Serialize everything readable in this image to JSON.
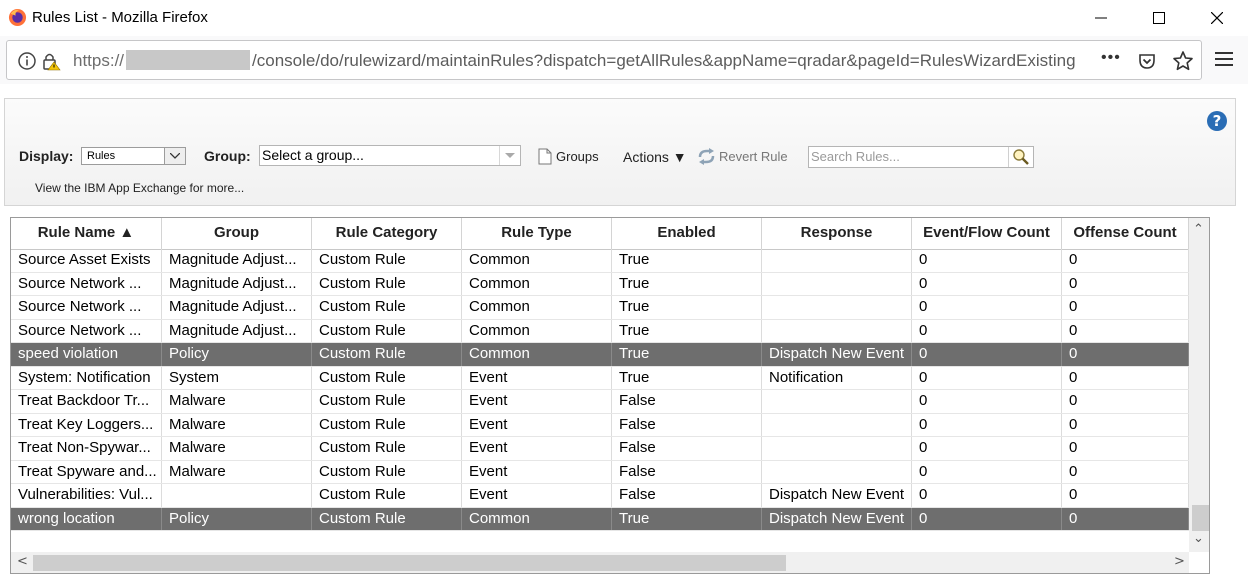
{
  "window": {
    "title": "Rules List - Mozilla Firefox"
  },
  "address_bar": {
    "prefix": "https://",
    "path": "/console/do/rulewizard/maintainRules?dispatch=getAllRules&appName=qradar&pageId=RulesWizardExisting",
    "more_label": "•••"
  },
  "toolbar": {
    "display_label": "Display:",
    "display_value": "Rules",
    "group_label": "Group:",
    "group_value": "Select a group...",
    "groups_label": "Groups",
    "actions_label": "Actions ▼",
    "revert_label": "Revert Rule",
    "search_placeholder": "Search Rules...",
    "app_exchange_link": "View the IBM App Exchange for more..."
  },
  "grid": {
    "columns": [
      "Rule Name ▲",
      "Group",
      "Rule Category",
      "Rule Type",
      "Enabled",
      "Response",
      "Event/Flow Count",
      "Offense Count"
    ],
    "rows": [
      {
        "cells": [
          "Source Asset Exists",
          "Magnitude Adjust...",
          "Custom Rule",
          "Common",
          "True",
          "",
          "0",
          "0"
        ],
        "selected": false
      },
      {
        "cells": [
          "Source Network ...",
          "Magnitude Adjust...",
          "Custom Rule",
          "Common",
          "True",
          "",
          "0",
          "0"
        ],
        "selected": false
      },
      {
        "cells": [
          "Source Network ...",
          "Magnitude Adjust...",
          "Custom Rule",
          "Common",
          "True",
          "",
          "0",
          "0"
        ],
        "selected": false
      },
      {
        "cells": [
          "Source Network ...",
          "Magnitude Adjust...",
          "Custom Rule",
          "Common",
          "True",
          "",
          "0",
          "0"
        ],
        "selected": false
      },
      {
        "cells": [
          "speed violation",
          "Policy",
          "Custom Rule",
          "Common",
          "True",
          "Dispatch New Event",
          "0",
          "0"
        ],
        "selected": true
      },
      {
        "cells": [
          "System: Notification",
          "System",
          "Custom Rule",
          "Event",
          "True",
          "Notification",
          "0",
          "0"
        ],
        "selected": false
      },
      {
        "cells": [
          "Treat Backdoor Tr...",
          "Malware",
          "Custom Rule",
          "Event",
          "False",
          "",
          "0",
          "0"
        ],
        "selected": false
      },
      {
        "cells": [
          "Treat Key Loggers...",
          "Malware",
          "Custom Rule",
          "Event",
          "False",
          "",
          "0",
          "0"
        ],
        "selected": false
      },
      {
        "cells": [
          "Treat Non-Spywar...",
          "Malware",
          "Custom Rule",
          "Event",
          "False",
          "",
          "0",
          "0"
        ],
        "selected": false
      },
      {
        "cells": [
          "Treat Spyware and...",
          "Malware",
          "Custom Rule",
          "Event",
          "False",
          "",
          "0",
          "0"
        ],
        "selected": false
      },
      {
        "cells": [
          "Vulnerabilities: Vul...",
          "",
          "Custom Rule",
          "Event",
          "False",
          "Dispatch New Event",
          "0",
          "0"
        ],
        "selected": false
      },
      {
        "cells": [
          "wrong location",
          "Policy",
          "Custom Rule",
          "Common",
          "True",
          "Dispatch New Event",
          "0",
          "0"
        ],
        "selected": true
      }
    ]
  }
}
